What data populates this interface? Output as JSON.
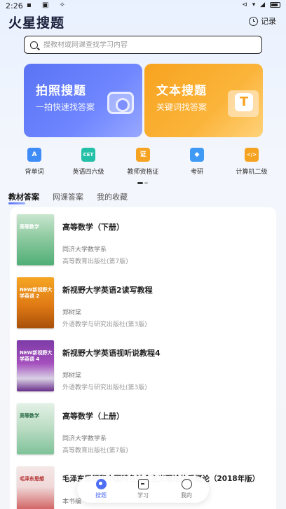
{
  "status_bar": {
    "time": "2:26",
    "left_icons": "▪ ▣ ✧",
    "right_icons": "⊲ ▾ ◢"
  },
  "header": {
    "title": "火星搜题",
    "record_label": "记录"
  },
  "search": {
    "placeholder": "搜教材或网课查找学习内容"
  },
  "feature_cards": [
    {
      "title": "拍照搜题",
      "subtitle": "一拍快速找答案"
    },
    {
      "title": "文本搜题",
      "subtitle": "关键词找答案"
    }
  ],
  "categories": [
    {
      "label": "背单词",
      "icon_text": "A",
      "color": "#3f8cf7"
    },
    {
      "label": "英语四六级",
      "icon_text": "CET",
      "color": "#23bfa6"
    },
    {
      "label": "教师资格证",
      "icon_text": "证",
      "color": "#f6a321"
    },
    {
      "label": "考研",
      "icon_text": "◆",
      "color": "#3f9af6"
    },
    {
      "label": "计算机二级",
      "icon_text": "</>",
      "color": "#f6a321"
    }
  ],
  "tabs": [
    {
      "label": "教材答案",
      "active": true
    },
    {
      "label": "网课答案",
      "active": false
    },
    {
      "label": "我的收藏",
      "active": false
    }
  ],
  "books": [
    {
      "title": "高等数学（下册）",
      "author": "同济大学数学系",
      "publisher": "高等教育出版社(第7版)",
      "cover_text": "高等数学"
    },
    {
      "title": "新视野大学英语2读写教程",
      "author": "郑树棠",
      "publisher": "外语教学与研究出版社(第3版)",
      "cover_text": "NEW新视野大学英语 2"
    },
    {
      "title": "新视野大学英语视听说教程4",
      "author": "郑树棠",
      "publisher": "外语教学与研究出版社(第3版)",
      "cover_text": "NEW新视野大学英语 4"
    },
    {
      "title": "高等数学（上册）",
      "author": "同济大学数学系",
      "publisher": "高等教育出版社(第7版)",
      "cover_text": "高等数学"
    },
    {
      "title": "毛泽东思想和中国特色社会主义理论体系概论（2018年版）",
      "author": "本书编",
      "publisher": "",
      "cover_text": "毛泽东思想"
    }
  ],
  "bottom_nav": [
    {
      "label": "搜题",
      "active": true
    },
    {
      "label": "学习",
      "active": false
    },
    {
      "label": "我的",
      "active": false
    }
  ]
}
